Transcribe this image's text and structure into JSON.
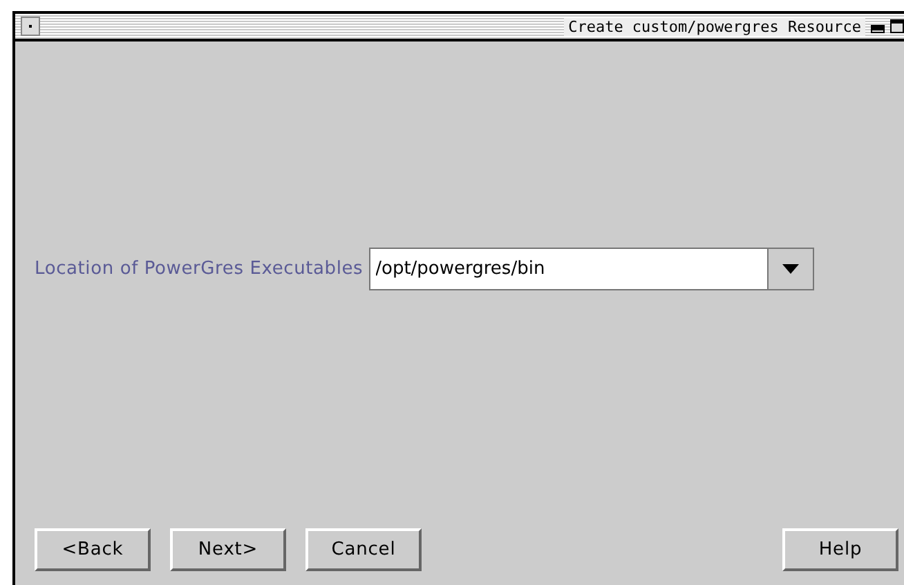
{
  "window": {
    "title": "Create custom/powergres Resource"
  },
  "field": {
    "label": "Location of PowerGres Executables",
    "value": "/opt/powergres/bin"
  },
  "buttons": [
    {
      "label": "<Back",
      "kind": "left"
    },
    {
      "label": "Next>",
      "kind": "left"
    },
    {
      "label": "Cancel",
      "kind": "left"
    },
    {
      "label": "Help",
      "kind": "right"
    }
  ]
}
